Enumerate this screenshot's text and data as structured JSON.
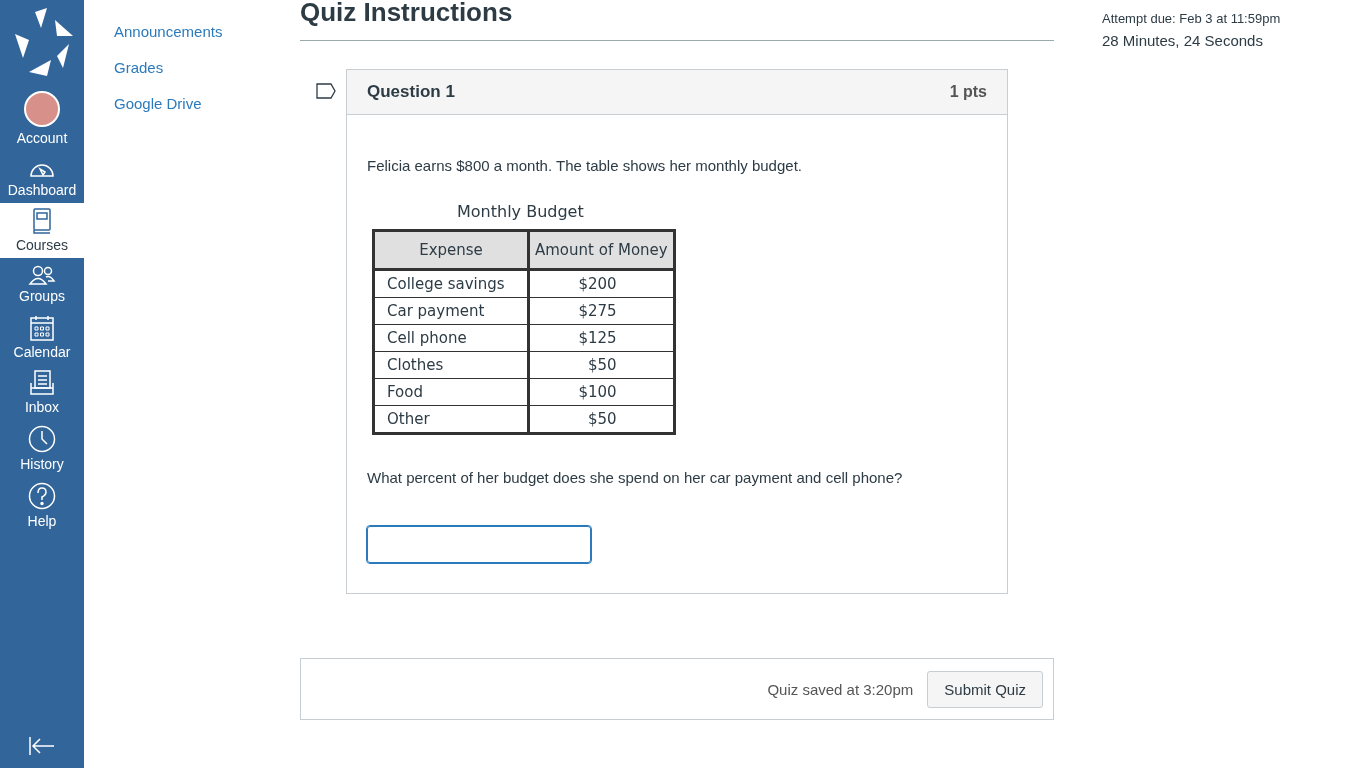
{
  "global_nav": [
    {
      "label": "Account",
      "selected": false
    },
    {
      "label": "Dashboard",
      "selected": false
    },
    {
      "label": "Courses",
      "selected": true
    },
    {
      "label": "Groups",
      "selected": false
    },
    {
      "label": "Calendar",
      "selected": false
    },
    {
      "label": "Inbox",
      "selected": false
    },
    {
      "label": "History",
      "selected": false
    },
    {
      "label": "Help",
      "selected": false
    }
  ],
  "course_nav": [
    "Announcements",
    "Grades",
    "Google Drive"
  ],
  "page_title": "Quiz Instructions",
  "question": {
    "title": "Question 1",
    "points": "1 pts",
    "intro": "Felicia earns $800 a month. The table shows her monthly budget.",
    "table": {
      "caption": "Monthly Budget",
      "columns": [
        "Expense",
        "Amount of Money"
      ],
      "rows": [
        [
          "College savings",
          "$200"
        ],
        [
          "Car payment",
          "$275"
        ],
        [
          "Cell phone",
          "$125"
        ],
        [
          "Clothes",
          "$50"
        ],
        [
          "Food",
          "$100"
        ],
        [
          "Other",
          "$50"
        ]
      ]
    },
    "prompt": "What percent of her budget does she spend on her car payment and cell phone?"
  },
  "footer": {
    "saved": "Quiz saved at 3:20pm",
    "submit": "Submit Quiz"
  },
  "sidebar": {
    "due": "Attempt due: Feb 3 at 11:59pm",
    "timer": "28 Minutes, 24 Seconds"
  }
}
